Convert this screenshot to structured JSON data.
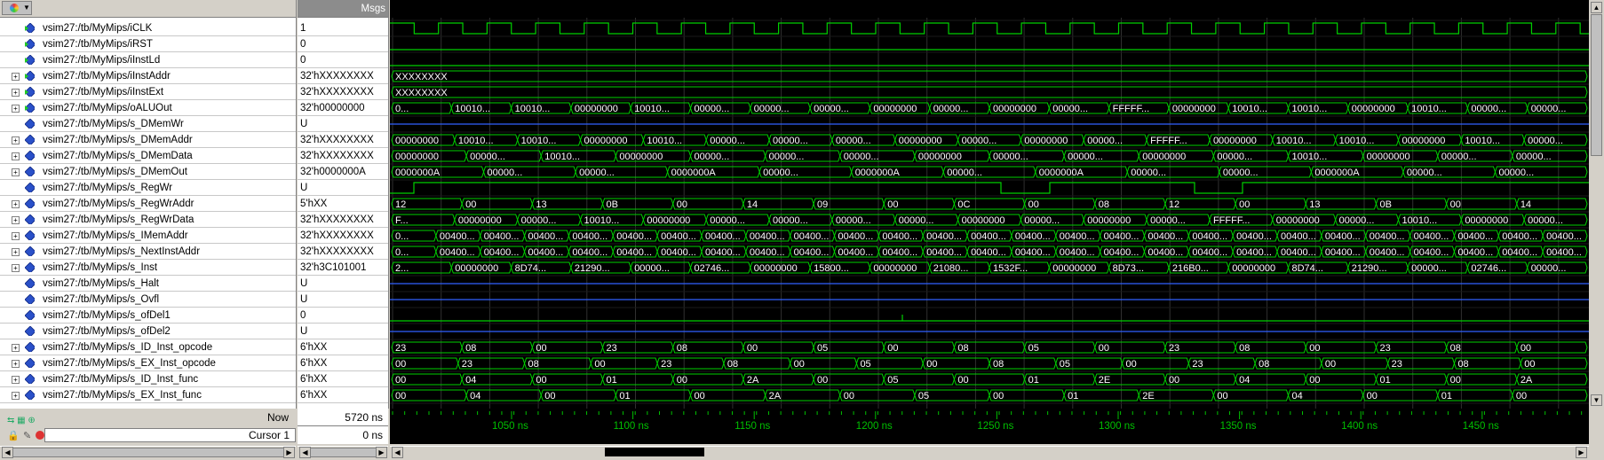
{
  "header": {
    "msgs_label": "Msgs"
  },
  "signals": [
    {
      "name": "vsim27:/tb/MyMips/iCLK",
      "value": "1",
      "expandable": false,
      "kind": "input"
    },
    {
      "name": "vsim27:/tb/MyMips/iRST",
      "value": "0",
      "expandable": false,
      "kind": "input"
    },
    {
      "name": "vsim27:/tb/MyMips/iInstLd",
      "value": "0",
      "expandable": false,
      "kind": "input"
    },
    {
      "name": "vsim27:/tb/MyMips/iInstAddr",
      "value": "32'hXXXXXXXX",
      "expandable": true,
      "kind": "input"
    },
    {
      "name": "vsim27:/tb/MyMips/iInstExt",
      "value": "32'hXXXXXXXX",
      "expandable": true,
      "kind": "input"
    },
    {
      "name": "vsim27:/tb/MyMips/oALUOut",
      "value": "32'h00000000",
      "expandable": true,
      "kind": "output"
    },
    {
      "name": "vsim27:/tb/MyMips/s_DMemWr",
      "value": "U",
      "expandable": false,
      "kind": "internal"
    },
    {
      "name": "vsim27:/tb/MyMips/s_DMemAddr",
      "value": "32'hXXXXXXXX",
      "expandable": true,
      "kind": "internal"
    },
    {
      "name": "vsim27:/tb/MyMips/s_DMemData",
      "value": "32'hXXXXXXXX",
      "expandable": true,
      "kind": "internal"
    },
    {
      "name": "vsim27:/tb/MyMips/s_DMemOut",
      "value": "32'h0000000A",
      "expandable": true,
      "kind": "internal"
    },
    {
      "name": "vsim27:/tb/MyMips/s_RegWr",
      "value": "U",
      "expandable": false,
      "kind": "internal"
    },
    {
      "name": "vsim27:/tb/MyMips/s_RegWrAddr",
      "value": "5'hXX",
      "expandable": true,
      "kind": "internal"
    },
    {
      "name": "vsim27:/tb/MyMips/s_RegWrData",
      "value": "32'hXXXXXXXX",
      "expandable": true,
      "kind": "internal"
    },
    {
      "name": "vsim27:/tb/MyMips/s_IMemAddr",
      "value": "32'hXXXXXXXX",
      "expandable": true,
      "kind": "internal"
    },
    {
      "name": "vsim27:/tb/MyMips/s_NextInstAddr",
      "value": "32'hXXXXXXXX",
      "expandable": true,
      "kind": "internal"
    },
    {
      "name": "vsim27:/tb/MyMips/s_Inst",
      "value": "32'h3C101001",
      "expandable": true,
      "kind": "internal"
    },
    {
      "name": "vsim27:/tb/MyMips/s_Halt",
      "value": "U",
      "expandable": false,
      "kind": "internal"
    },
    {
      "name": "vsim27:/tb/MyMips/s_Ovfl",
      "value": "U",
      "expandable": false,
      "kind": "internal"
    },
    {
      "name": "vsim27:/tb/MyMips/s_ofDel1",
      "value": "0",
      "expandable": false,
      "kind": "internal"
    },
    {
      "name": "vsim27:/tb/MyMips/s_ofDel2",
      "value": "U",
      "expandable": false,
      "kind": "internal"
    },
    {
      "name": "vsim27:/tb/MyMips/s_ID_Inst_opcode",
      "value": "6'hXX",
      "expandable": true,
      "kind": "internal"
    },
    {
      "name": "vsim27:/tb/MyMips/s_EX_Inst_opcode",
      "value": "6'hXX",
      "expandable": true,
      "kind": "internal"
    },
    {
      "name": "vsim27:/tb/MyMips/s_ID_Inst_func",
      "value": "6'hXX",
      "expandable": true,
      "kind": "internal"
    },
    {
      "name": "vsim27:/tb/MyMips/s_EX_Inst_func",
      "value": "6'hXX",
      "expandable": true,
      "kind": "internal"
    }
  ],
  "bus_labels": [
    [
      "XXXXXXXX"
    ],
    [
      "XXXXXXXX"
    ],
    [
      "0...",
      "10010...",
      "10010...",
      "00000000",
      "10010...",
      "00000...",
      "00000...",
      "00000...",
      "00000000",
      "00000...",
      "00000000",
      "00000...",
      "FFFFF...",
      "00000000",
      "10010...",
      "10010...",
      "00000000",
      "10010...",
      "00000...",
      "00000..."
    ],
    [
      "00000000",
      "10010...",
      "10010...",
      "00000000",
      "10010...",
      "00000...",
      "00000...",
      "00000...",
      "00000000",
      "00000...",
      "00000000",
      "00000...",
      "FFFFF...",
      "00000000",
      "10010...",
      "10010...",
      "00000000",
      "10010...",
      "00000..."
    ],
    [
      "00000000",
      "00000...",
      "10010...",
      "00000000",
      "00000...",
      "00000...",
      "00000...",
      "00000000",
      "00000...",
      "00000...",
      "00000000",
      "00000...",
      "10010...",
      "00000000",
      "00000...",
      "00000..."
    ],
    [
      "0000000A",
      "00000...",
      "00000...",
      "0000000A",
      "00000...",
      "0000000A",
      "00000...",
      "0000000A",
      "00000...",
      "00000...",
      "0000000A",
      "00000...",
      "00000..."
    ],
    [
      "12",
      "00",
      "13",
      "0B",
      "00",
      "14",
      "09",
      "00",
      "0C",
      "00",
      "08",
      "12",
      "00",
      "13",
      "0B",
      "00",
      "14"
    ],
    [
      "F...",
      "00000000",
      "00000...",
      "10010...",
      "00000000",
      "00000...",
      "00000...",
      "00000...",
      "00000...",
      "00000000",
      "00000...",
      "00000000",
      "00000...",
      "FFFFF...",
      "00000000",
      "00000...",
      "10010...",
      "00000000",
      "00000..."
    ],
    [
      "0...",
      "00400...",
      "00400...",
      "00400...",
      "00400...",
      "00400...",
      "00400...",
      "00400...",
      "00400...",
      "00400...",
      "00400...",
      "00400...",
      "00400...",
      "00400...",
      "00400...",
      "00400...",
      "00400...",
      "00400...",
      "00400...",
      "00400...",
      "00400...",
      "00400...",
      "00400...",
      "00400...",
      "00400...",
      "00400...",
      "00400..."
    ],
    [
      "0...",
      "00400...",
      "00400...",
      "00400...",
      "00400...",
      "00400...",
      "00400...",
      "00400...",
      "00400...",
      "00400...",
      "00400...",
      "00400...",
      "00400...",
      "00400...",
      "00400...",
      "00400...",
      "00400...",
      "00400...",
      "00400...",
      "00400...",
      "00400...",
      "00400...",
      "00400...",
      "00400...",
      "00400...",
      "00400...",
      "00400..."
    ],
    [
      "2...",
      "00000000",
      "8D74...",
      "21290...",
      "00000...",
      "02746...",
      "00000000",
      "15800...",
      "00000000",
      "21080...",
      "1532F...",
      "00000000",
      "8D73...",
      "216B0...",
      "00000000",
      "8D74...",
      "21290...",
      "00000...",
      "02746...",
      "00000..."
    ],
    [
      "23",
      "08",
      "00",
      "23",
      "08",
      "00",
      "05",
      "00",
      "08",
      "05",
      "00",
      "23",
      "08",
      "00",
      "23",
      "08",
      "00"
    ],
    [
      "00",
      "23",
      "08",
      "00",
      "23",
      "08",
      "00",
      "05",
      "00",
      "08",
      "05",
      "00",
      "23",
      "08",
      "00",
      "23",
      "08",
      "00"
    ],
    [
      "00",
      "04",
      "00",
      "01",
      "00",
      "2A",
      "00",
      "05",
      "00",
      "01",
      "2E",
      "00",
      "04",
      "00",
      "01",
      "00",
      "2A"
    ],
    [
      "00",
      "04",
      "00",
      "01",
      "00",
      "2A",
      "00",
      "05",
      "00",
      "01",
      "2E",
      "00",
      "04",
      "00",
      "01",
      "00"
    ]
  ],
  "status": {
    "now_label": "Now",
    "now_value": "5720 ns",
    "cursor_label": "Cursor 1",
    "cursor_value": "0 ns"
  },
  "timeline": {
    "ticks": [
      "1050 ns",
      "1100 ns",
      "1150 ns",
      "1200 ns",
      "1250 ns",
      "1300 ns",
      "1350 ns",
      "1400 ns",
      "1450 ns"
    ]
  },
  "colors": {
    "wave": "#00d000",
    "grid": "#303030",
    "background": "#000000",
    "cursor": "#e0e0e0"
  }
}
